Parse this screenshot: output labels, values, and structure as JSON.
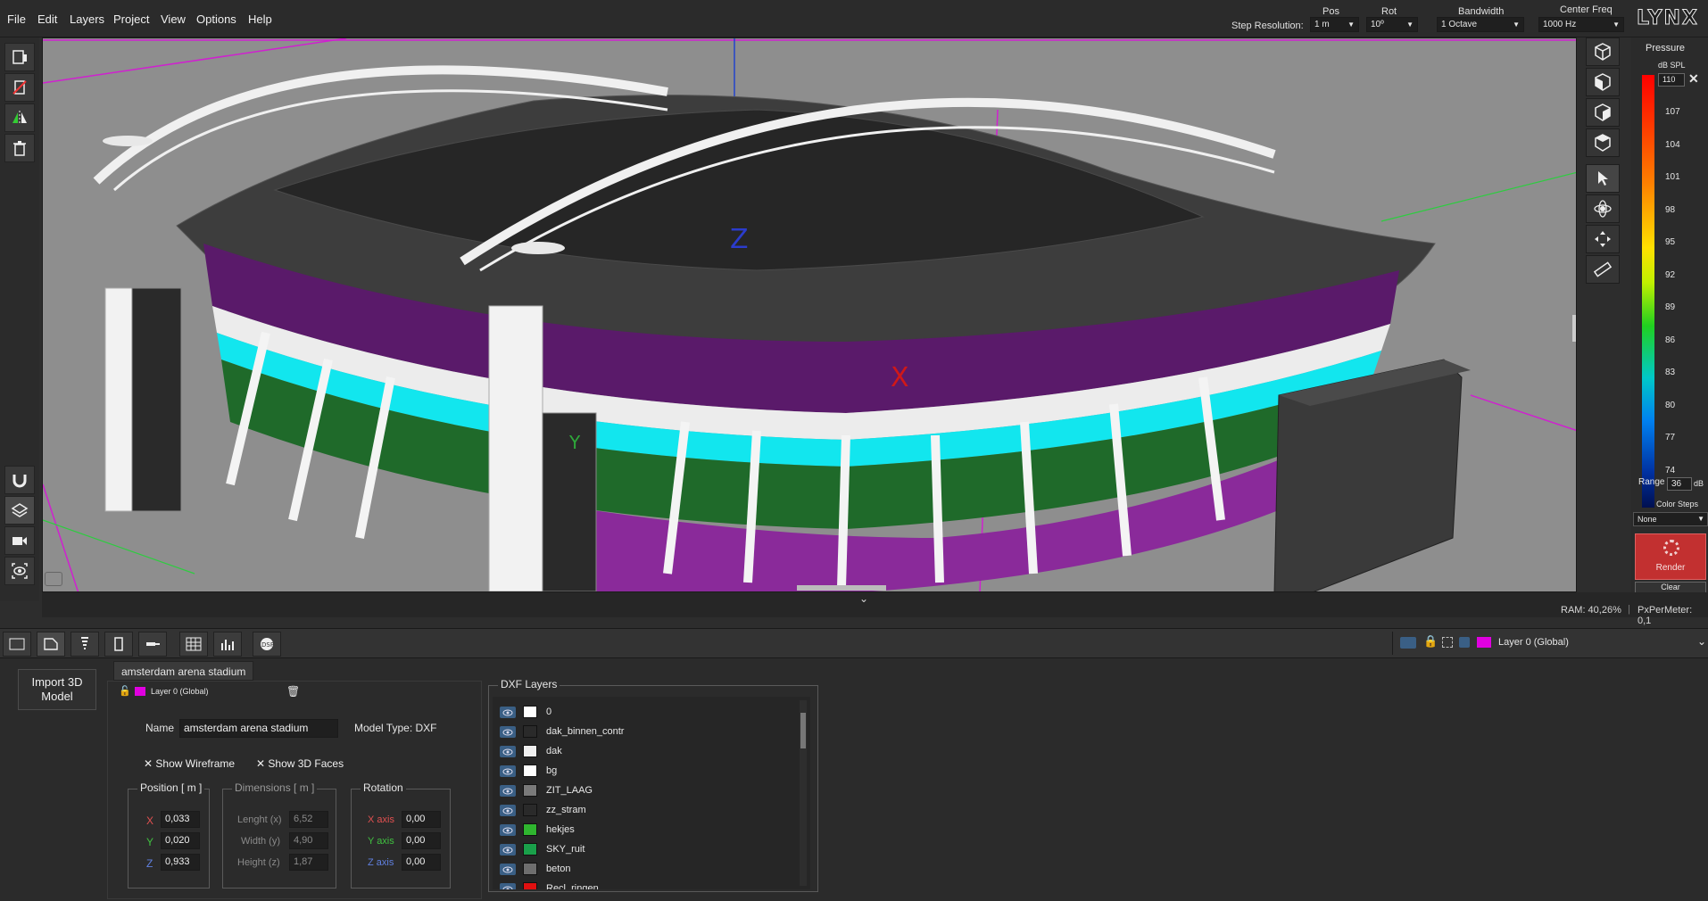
{
  "menu": {
    "file": "File",
    "edit": "Edit",
    "layers": "Layers",
    "project": "Project",
    "view": "View",
    "options": "Options",
    "help": "Help"
  },
  "toolbar": {
    "step_resolution_label": "Step Resolution:",
    "pos_label": "Pos",
    "pos_value": "1 m",
    "rot_label": "Rot",
    "rot_value": "10º",
    "bandwidth_label": "Bandwidth",
    "bandwidth_value": "1 Octave",
    "center_freq_label": "Center Freq",
    "center_freq_value": "1000 Hz",
    "logo": "LYNX"
  },
  "viewport": {
    "axis_x": "X",
    "axis_y": "Y",
    "axis_z": "Z"
  },
  "pressure": {
    "title": "Pressure",
    "unit": "dB SPL",
    "max_value": "110",
    "scale": [
      "107",
      "104",
      "101",
      "98",
      "95",
      "92",
      "89",
      "86",
      "83",
      "80",
      "77",
      "74"
    ],
    "range_label": "Range",
    "range_value": "36",
    "range_unit": "dB",
    "color_steps_label": "Color Steps",
    "color_steps_value": "None",
    "render_label": "Render",
    "clear_label": "Clear"
  },
  "status": {
    "ram": "RAM: 40,26%",
    "px_per_meter": "PxPerMeter: 0,1"
  },
  "layer_selector": {
    "value": "Layer 0 (Global)",
    "color": "#e000e0"
  },
  "panel": {
    "import_button": "Import 3D Model",
    "model_tab": "amsterdam arena stadium",
    "layer_label": "Layer 0 (Global)",
    "name_label": "Name",
    "name_value": "amsterdam arena stadium",
    "model_type": "Model Type: DXF",
    "show_wireframe": "Show Wireframe",
    "show_faces": "Show 3D Faces",
    "position": {
      "title": "Position [ m ]",
      "x_label": "X",
      "x": "0,033",
      "y_label": "Y",
      "y": "0,020",
      "z_label": "Z",
      "z": "0,933"
    },
    "dimensions": {
      "title": "Dimensions [ m ]",
      "l_label": "Lenght (x)",
      "l": "6,52",
      "w_label": "Width (y)",
      "w": "4,90",
      "h_label": "Height (z)",
      "h": "1,87"
    },
    "rotation": {
      "title": "Rotation",
      "x_label": "X axis",
      "x": "0,00",
      "y_label": "Y axis",
      "y": "0,00",
      "z_label": "Z axis",
      "z": "0,00"
    },
    "dxf_title": "DXF Layers",
    "dxf_layers": [
      {
        "name": "0",
        "color": "#ffffff"
      },
      {
        "name": "dak_binnen_contr",
        "color": "#2a2a2a"
      },
      {
        "name": "dak",
        "color": "#f0f0f0"
      },
      {
        "name": "bg",
        "color": "#ffffff"
      },
      {
        "name": "ZIT_LAAG",
        "color": "#7a7a7a"
      },
      {
        "name": "zz_stram",
        "color": "#2a2a2a"
      },
      {
        "name": "hekjes",
        "color": "#2fb52f"
      },
      {
        "name": "SKY_ruit",
        "color": "#1aa04a"
      },
      {
        "name": "beton",
        "color": "#6e6e6e"
      },
      {
        "name": "Recl_ringen",
        "color": "#e01010"
      }
    ]
  }
}
